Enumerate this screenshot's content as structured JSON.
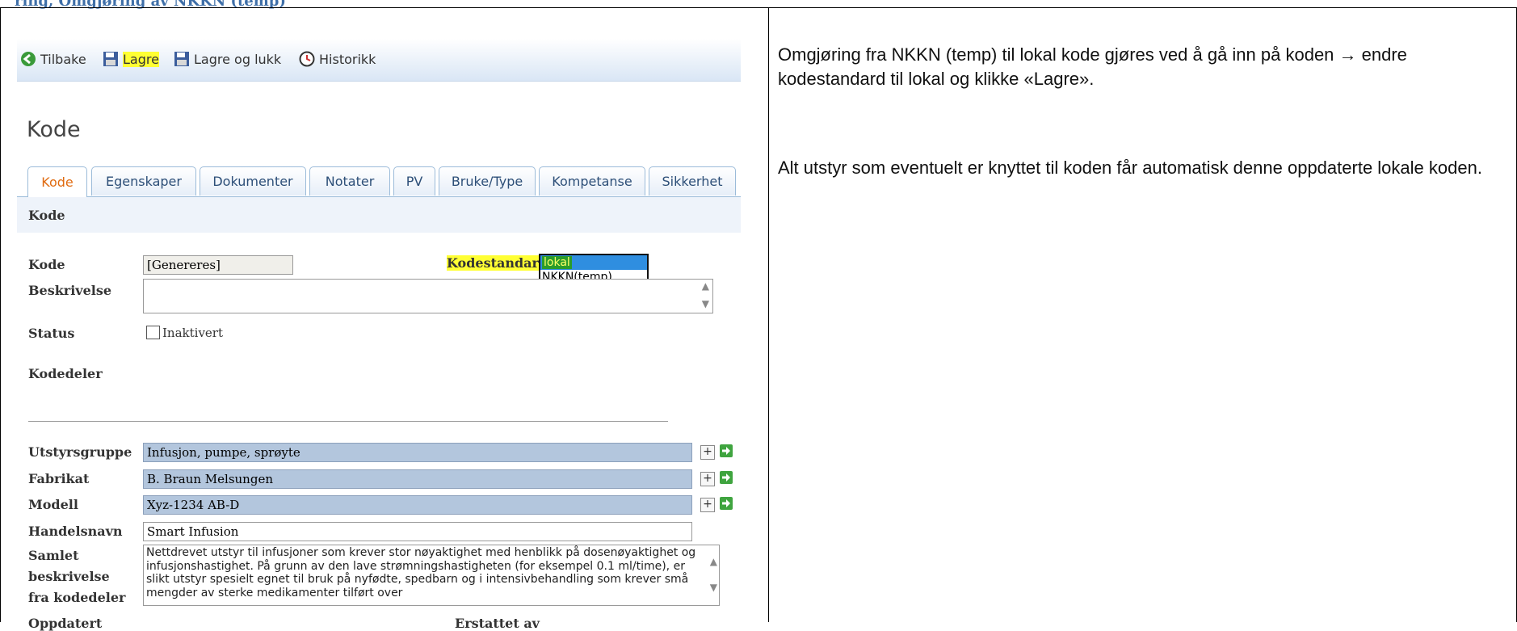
{
  "document_heading": "ring, Omgjøring av NKKN (temp)",
  "toolbar": {
    "back_label": "Tilbake",
    "save_label": "Lagre",
    "save_close_label": "Lagre og lukk",
    "history_label": "Historikk"
  },
  "page_title": "Kode",
  "tabs": [
    "Kode",
    "Egenskaper",
    "Dokumenter",
    "Notater",
    "PV",
    "Bruke/Type",
    "Kompetanse",
    "Sikkerhet"
  ],
  "active_tab": "Kode",
  "section_title": "Kode",
  "form": {
    "kode_label": "Kode",
    "kode_value": "[Genereres]",
    "kodestandard_label": "Kodestandard",
    "kodestandard_options": [
      "lokal",
      "NKKN(temp)"
    ],
    "kodestandard_selected": "lokal",
    "beskrivelse_label": "Beskrivelse",
    "beskrivelse_value": "",
    "status_label": "Status",
    "inaktivert_label": "Inaktivert",
    "inaktivert_checked": false,
    "kodedeler_label": "Kodedeler",
    "utstyrsgruppe_label": "Utstyrsgruppe",
    "utstyrsgruppe_value": "Infusjon, pumpe, sprøyte",
    "fabrikat_label": "Fabrikat",
    "fabrikat_value": "B. Braun Melsungen",
    "modell_label": "Modell",
    "modell_value": "Xyz-1234 AB-D",
    "handelsnavn_label": "Handelsnavn",
    "handelsnavn_value": "Smart Infusion",
    "samlet_label_1": "Samlet",
    "samlet_label_2": "beskrivelse",
    "samlet_label_3": "fra kodedeler",
    "samlet_value": "Nettdrevet utstyr til infusjoner som krever stor nøyaktighet med henblikk på dosenøyaktighet og infusjonshastighet. På grunn av den lave strømningshastigheten (for eksempel 0.1 ml/time), er slikt utstyr spesielt egnet til bruk på nyfødte, spedbarn og i intensivbehandling som krever små mengder av sterke medikamenter tilført over",
    "plus_label": "+",
    "oppdatert_label": "Oppdatert",
    "erstattet_label": "Erstattet av"
  },
  "notes": {
    "paragraph_1": "Omgjøring fra NKKN (temp) til lokal kode gjøres ved å gå inn på koden → endre kodestandard til lokal og klikke «Lagre».",
    "paragraph_2": "Alt utstyr som eventuelt er knyttet til koden får automatisk denne oppdaterte lokale koden."
  },
  "colors": {
    "highlight": "#ffff33",
    "tab_active_text": "#e06b10",
    "field_blue": "#b3c6dd",
    "go_green": "#3fa43f"
  }
}
